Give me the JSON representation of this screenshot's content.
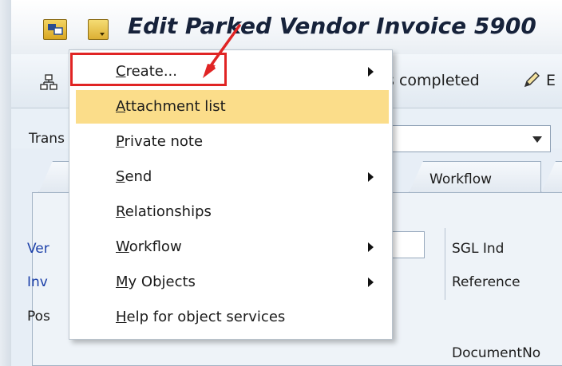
{
  "window": {
    "title": "Edit Parked Vendor Invoice 5900"
  },
  "toolbar": {
    "completed_label": "s completed",
    "edge_text": "E"
  },
  "transaction": {
    "label": "Trans"
  },
  "tabs": {
    "workflow_label": "Workflow"
  },
  "fields": {
    "vendor_label": "Ver",
    "invoice_label": "Inv",
    "posting_label": "Pos",
    "sgl_ind_label": "SGL Ind",
    "reference_label": "Reference",
    "documentno_label": "DocumentNo"
  },
  "menu": {
    "items": [
      {
        "label": "Create...",
        "submenu": true
      },
      {
        "label": "Attachment list",
        "submenu": false
      },
      {
        "label": "Private note",
        "submenu": false
      },
      {
        "label": "Send",
        "submenu": true
      },
      {
        "label": "Relationships",
        "submenu": false
      },
      {
        "label": "Workflow",
        "submenu": true
      },
      {
        "label": "My Objects",
        "submenu": true
      },
      {
        "label": "Help for object services",
        "submenu": false
      }
    ],
    "highlighted_index": 1
  },
  "colors": {
    "highlight": "#fbdd8a",
    "annotation": "#e02424",
    "field_label_blue": "#1b3fa8"
  }
}
